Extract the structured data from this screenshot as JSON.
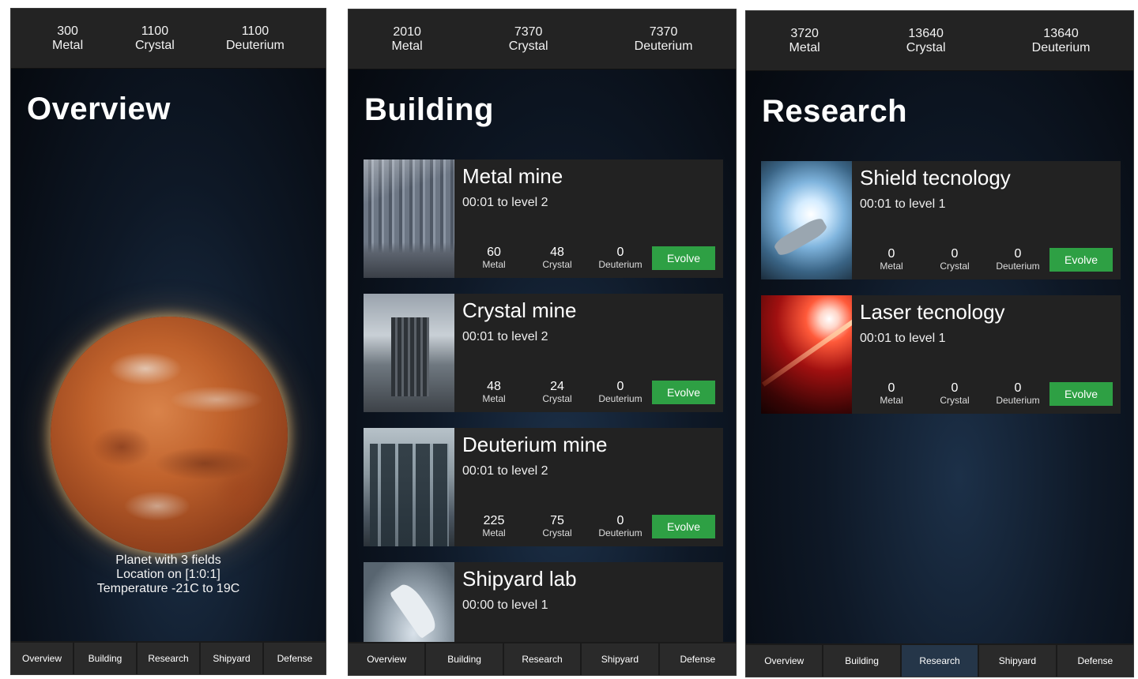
{
  "screens": [
    {
      "resources": [
        {
          "value": "300",
          "label": "Metal"
        },
        {
          "value": "1100",
          "label": "Crystal"
        },
        {
          "value": "1100",
          "label": "Deuterium"
        }
      ],
      "title": "Overview",
      "planet_info": [
        "Planet with 3 fields",
        "Location on [1:0:1]",
        "Temperature -21C to 19C"
      ],
      "nav": [
        "Overview",
        "Building",
        "Research",
        "Shipyard",
        "Defense"
      ]
    },
    {
      "resources": [
        {
          "value": "2010",
          "label": "Metal"
        },
        {
          "value": "7370",
          "label": "Crystal"
        },
        {
          "value": "7370",
          "label": "Deuterium"
        }
      ],
      "title": "Building",
      "cards": [
        {
          "name": "Metal mine",
          "time": "00:01 to level 2",
          "costs": [
            {
              "value": "60",
              "label": "Metal"
            },
            {
              "value": "48",
              "label": "Crystal"
            },
            {
              "value": "0",
              "label": "Deuterium"
            }
          ],
          "button": "Evolve"
        },
        {
          "name": "Crystal mine",
          "time": "00:01 to level 2",
          "costs": [
            {
              "value": "48",
              "label": "Metal"
            },
            {
              "value": "24",
              "label": "Crystal"
            },
            {
              "value": "0",
              "label": "Deuterium"
            }
          ],
          "button": "Evolve"
        },
        {
          "name": "Deuterium mine",
          "time": "00:01 to level 2",
          "costs": [
            {
              "value": "225",
              "label": "Metal"
            },
            {
              "value": "75",
              "label": "Crystal"
            },
            {
              "value": "0",
              "label": "Deuterium"
            }
          ],
          "button": "Evolve"
        },
        {
          "name": "Shipyard lab",
          "time": "00:00 to level 1"
        }
      ],
      "nav": [
        "Overview",
        "Building",
        "Research",
        "Shipyard",
        "Defense"
      ]
    },
    {
      "resources": [
        {
          "value": "3720",
          "label": "Metal"
        },
        {
          "value": "13640",
          "label": "Crystal"
        },
        {
          "value": "13640",
          "label": "Deuterium"
        }
      ],
      "title": "Research",
      "cards": [
        {
          "name": "Shield tecnology",
          "time": "00:01 to level 1",
          "costs": [
            {
              "value": "0",
              "label": "Metal"
            },
            {
              "value": "0",
              "label": "Crystal"
            },
            {
              "value": "0",
              "label": "Deuterium"
            }
          ],
          "button": "Evolve"
        },
        {
          "name": "Laser tecnology",
          "time": "00:01 to level 1",
          "costs": [
            {
              "value": "0",
              "label": "Metal"
            },
            {
              "value": "0",
              "label": "Crystal"
            },
            {
              "value": "0",
              "label": "Deuterium"
            }
          ],
          "button": "Evolve"
        }
      ],
      "nav": [
        "Overview",
        "Building",
        "Research",
        "Shipyard",
        "Defense"
      ],
      "active_tab": "Research"
    }
  ],
  "colors": {
    "evolve": "#2ea044",
    "panel": "#222222",
    "active_tab": "#253649"
  }
}
